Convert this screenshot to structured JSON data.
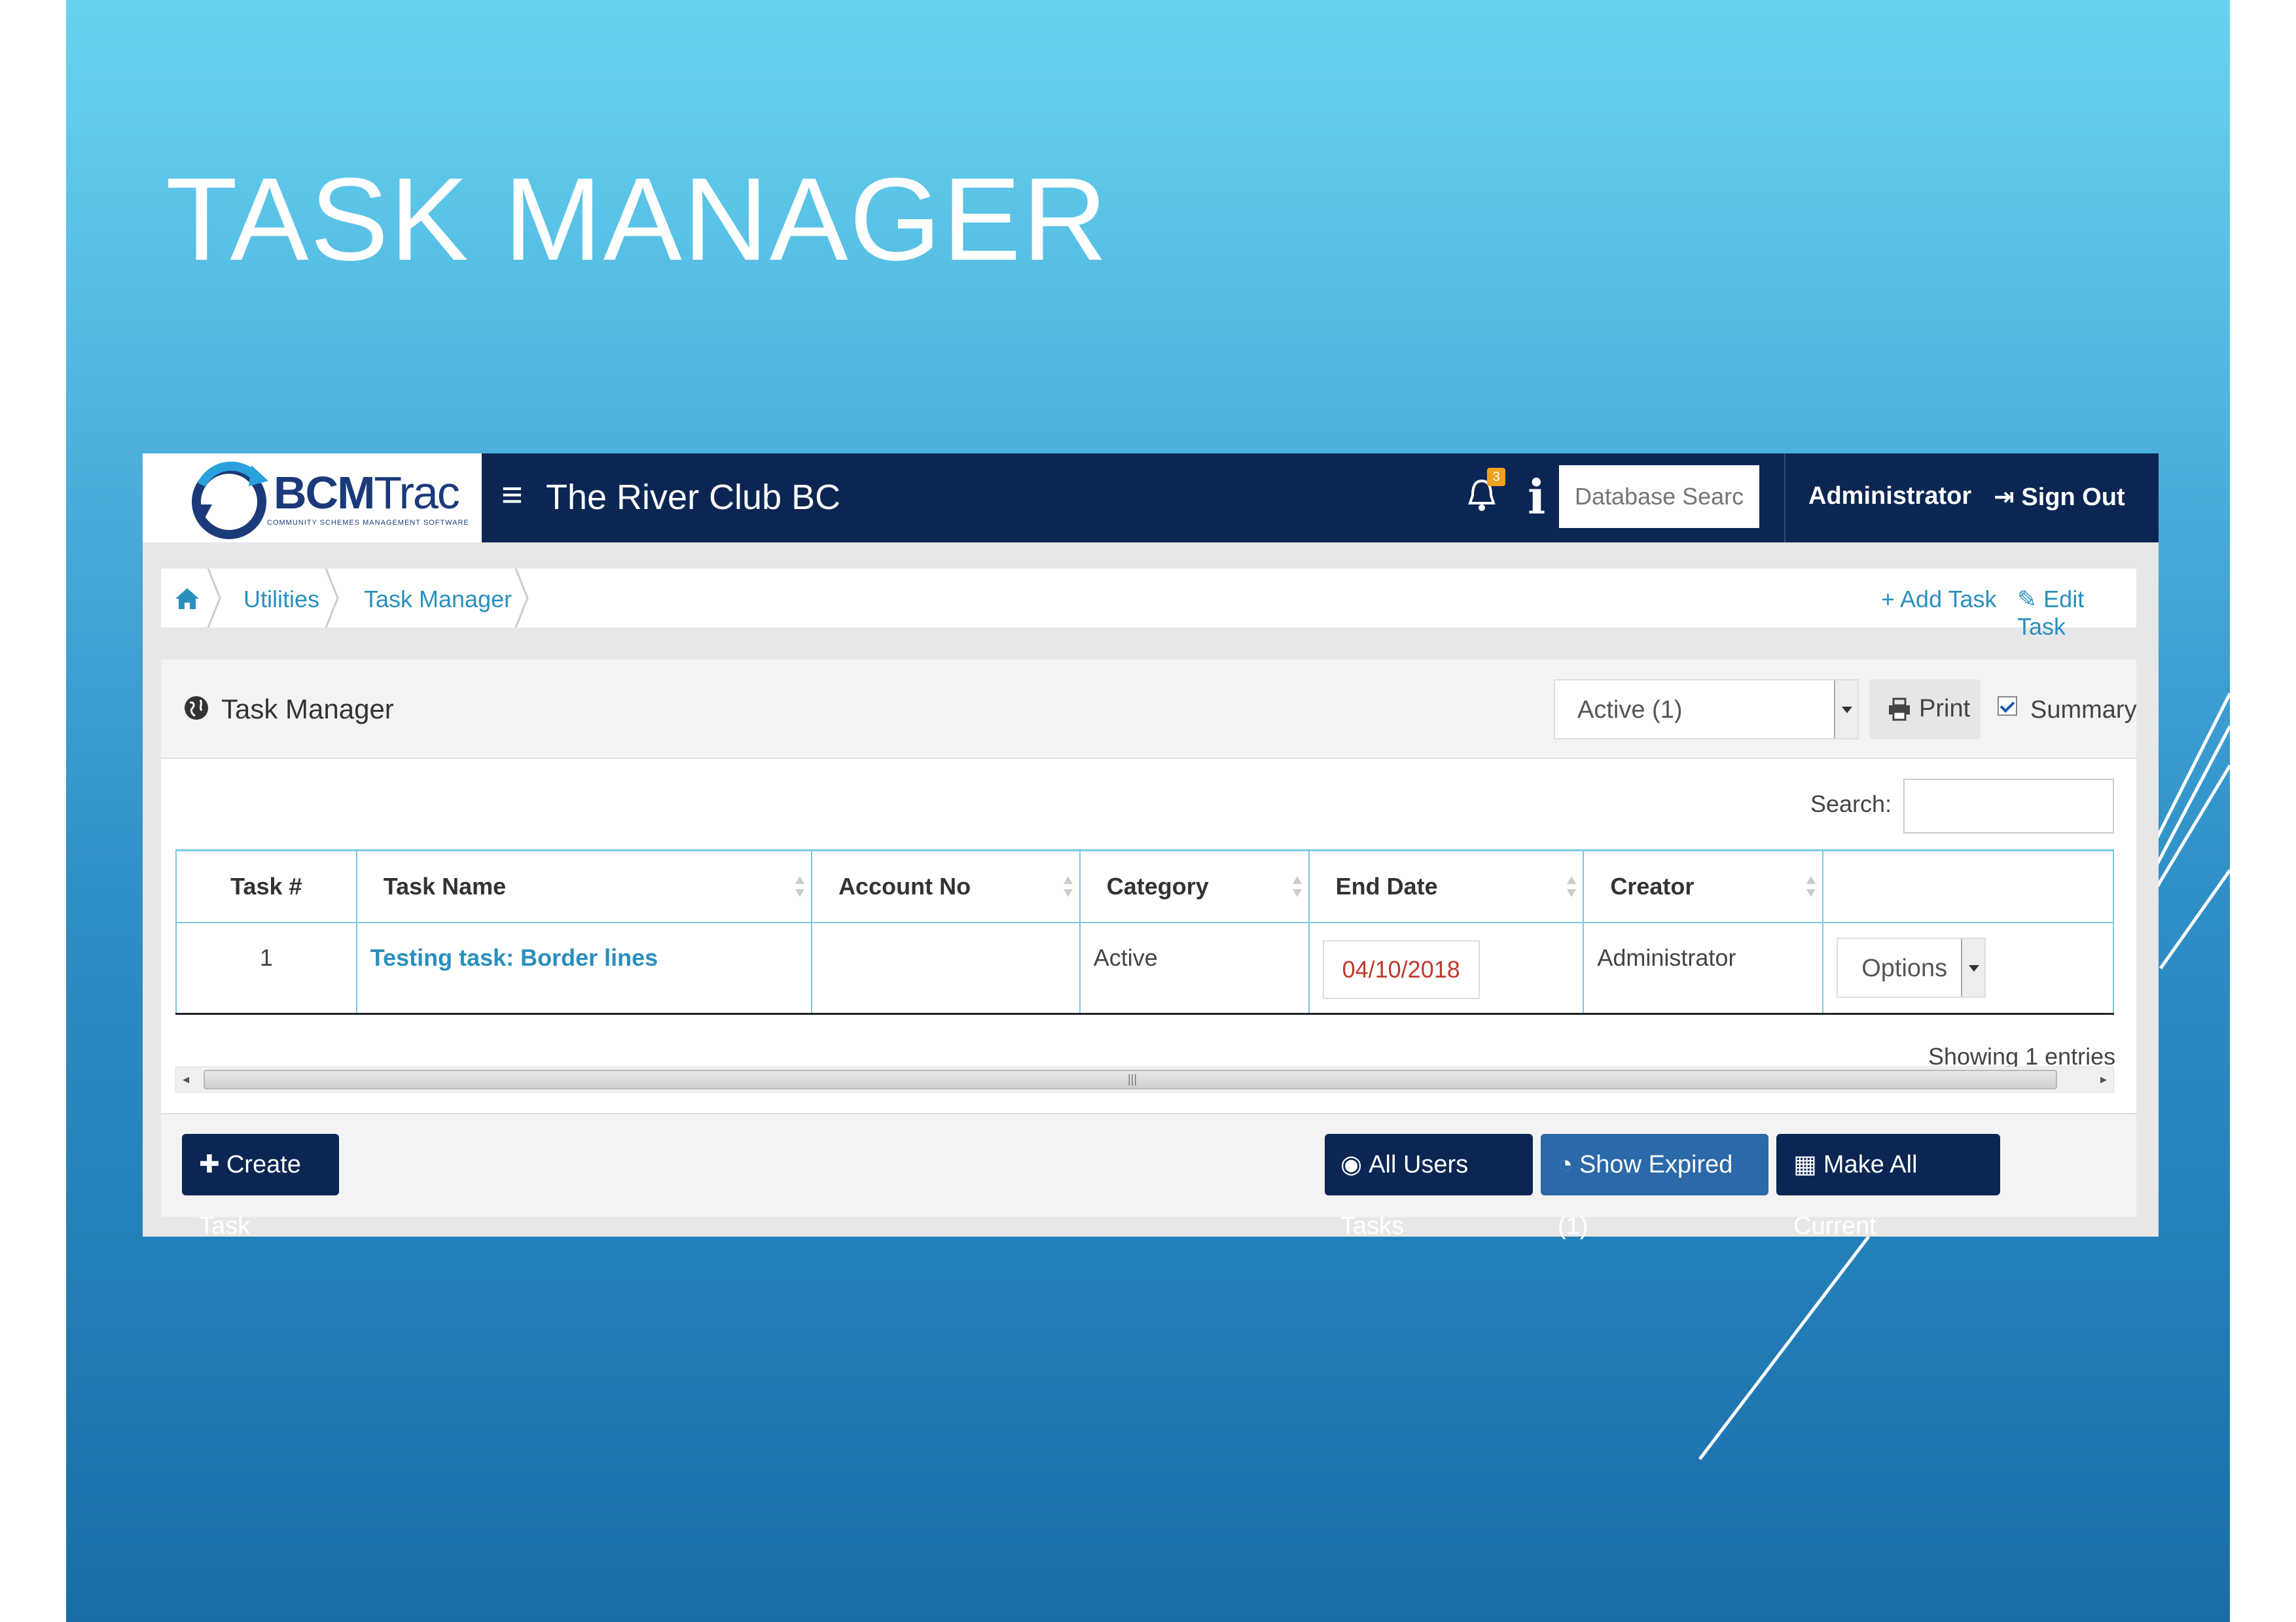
{
  "slide": {
    "title": "TASK MANAGER"
  },
  "brand": {
    "logo_main": "BCM",
    "logo_trac": "Trac",
    "logo_sub": "COMMUNITY SCHEMES MANAGEMENT SOFTWARE"
  },
  "header": {
    "club_name": "The River Club BC",
    "notification_count": "3",
    "search_placeholder": "Database Search",
    "user": "Administrator",
    "signout": "Sign Out"
  },
  "breadcrumb": {
    "items": [
      "Utilities",
      "Task Manager"
    ],
    "actions": {
      "add": "Add Task",
      "edit": "Edit Task"
    }
  },
  "panel": {
    "title": "Task Manager",
    "status_value": "Active (1)",
    "print_label": "Print",
    "summary_label": "Summary",
    "search_label": "Search:"
  },
  "table": {
    "headers": [
      "Task #",
      "Task Name",
      "Account No",
      "Category",
      "End Date",
      "Creator"
    ],
    "rows": [
      {
        "num": "1",
        "name": "Testing task: Border lines",
        "account": "",
        "category": "Active",
        "end_date": "04/10/2018",
        "creator": "Administrator",
        "options": "Options"
      }
    ],
    "footer": "Showing 1 entries"
  },
  "buttons": {
    "create": "Create Task",
    "all_users": "All Users Tasks",
    "show_expired": "Show Expired (1)",
    "make_current": "Make All Current"
  },
  "colors": {
    "navbar": "#0c2653",
    "link": "#2a8fbd",
    "date_red": "#c0392b",
    "slide_top": "#66d4ef",
    "slide_bottom": "#1a6ea8"
  }
}
